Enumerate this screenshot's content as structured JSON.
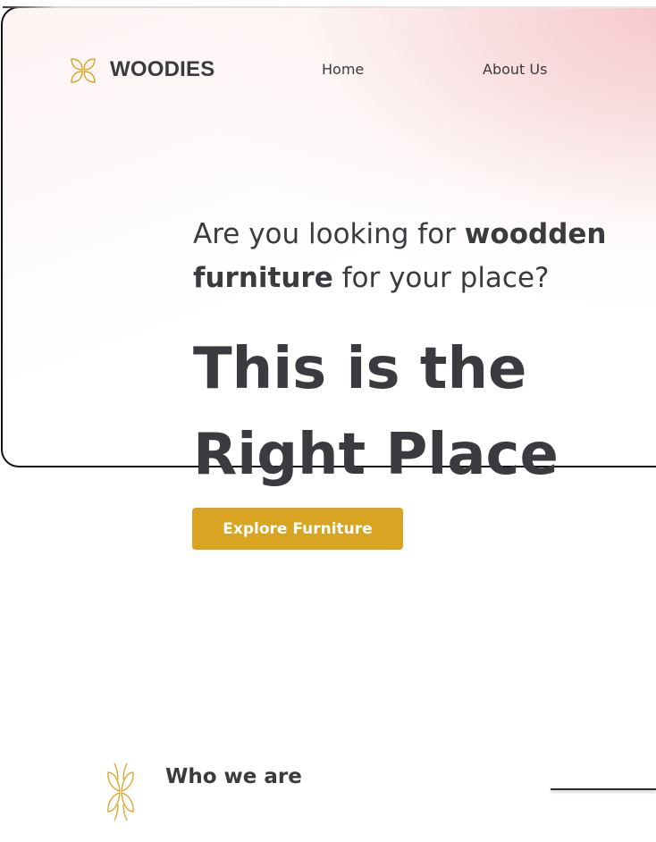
{
  "brand": {
    "name": "WOODIES",
    "icon": "flower-logo-icon",
    "accent_color": "#d9a421"
  },
  "nav": {
    "items": [
      {
        "label": "Home"
      },
      {
        "label": "About Us"
      }
    ]
  },
  "hero": {
    "question_prefix": "Are you looking for ",
    "question_bold": "woodden furniture",
    "question_suffix": " for your place?",
    "title_line1": "This is the",
    "title_line2": "Right Place",
    "cta_label": "Explore Furniture"
  },
  "about_section": {
    "title": "Who we are",
    "icon": "leaf-ornament-icon"
  },
  "colors": {
    "text": "#3a3b3f",
    "hero_gradient": "#f6c4c8",
    "button": "#d9a421"
  }
}
